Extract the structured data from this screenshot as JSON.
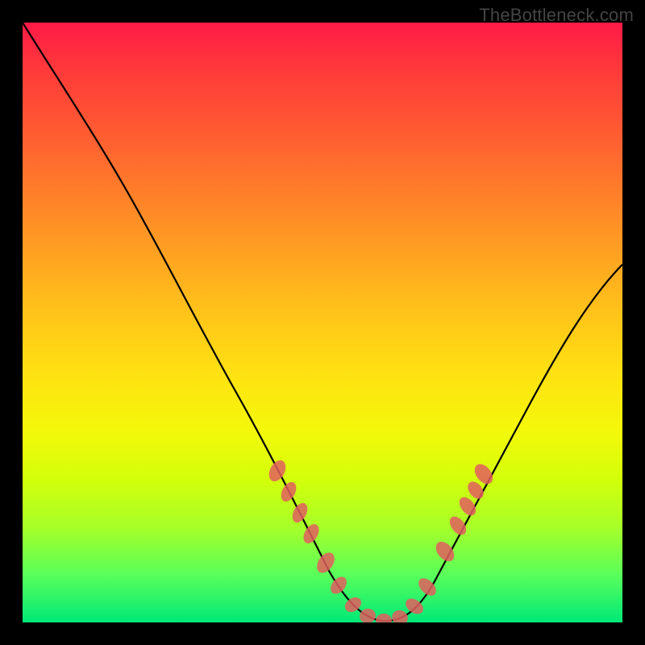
{
  "watermark": "TheBottleneck.com",
  "chart_data": {
    "type": "line",
    "title": "",
    "xlabel": "",
    "ylabel": "",
    "xlim": [
      0,
      100
    ],
    "ylim": [
      0,
      100
    ],
    "series": [
      {
        "name": "curve",
        "x": [
          0,
          5,
          10,
          15,
          20,
          25,
          30,
          35,
          40,
          45,
          48,
          50,
          52,
          55,
          58,
          60,
          62,
          65,
          70,
          75,
          80,
          85,
          90,
          95,
          100
        ],
        "y": [
          100,
          91,
          82,
          73,
          64,
          55,
          46,
          37,
          28,
          19,
          12,
          7,
          4,
          1,
          0,
          1,
          3,
          7,
          14,
          21,
          28,
          35,
          43,
          51,
          59
        ],
        "stroke": "#000000"
      },
      {
        "name": "highlight-dots",
        "x": [
          40,
          42,
          44,
          47,
          50,
          53,
          55,
          57,
          60,
          63,
          65,
          66,
          67,
          68
        ],
        "y": [
          28,
          24,
          20,
          14,
          7,
          3,
          1,
          0,
          1,
          5,
          10,
          13,
          17,
          21
        ],
        "stroke": "#e86a6a"
      }
    ],
    "gradient_colors": {
      "top": "#ff1a47",
      "mid": "#ffe012",
      "bottom": "#00e878"
    }
  }
}
